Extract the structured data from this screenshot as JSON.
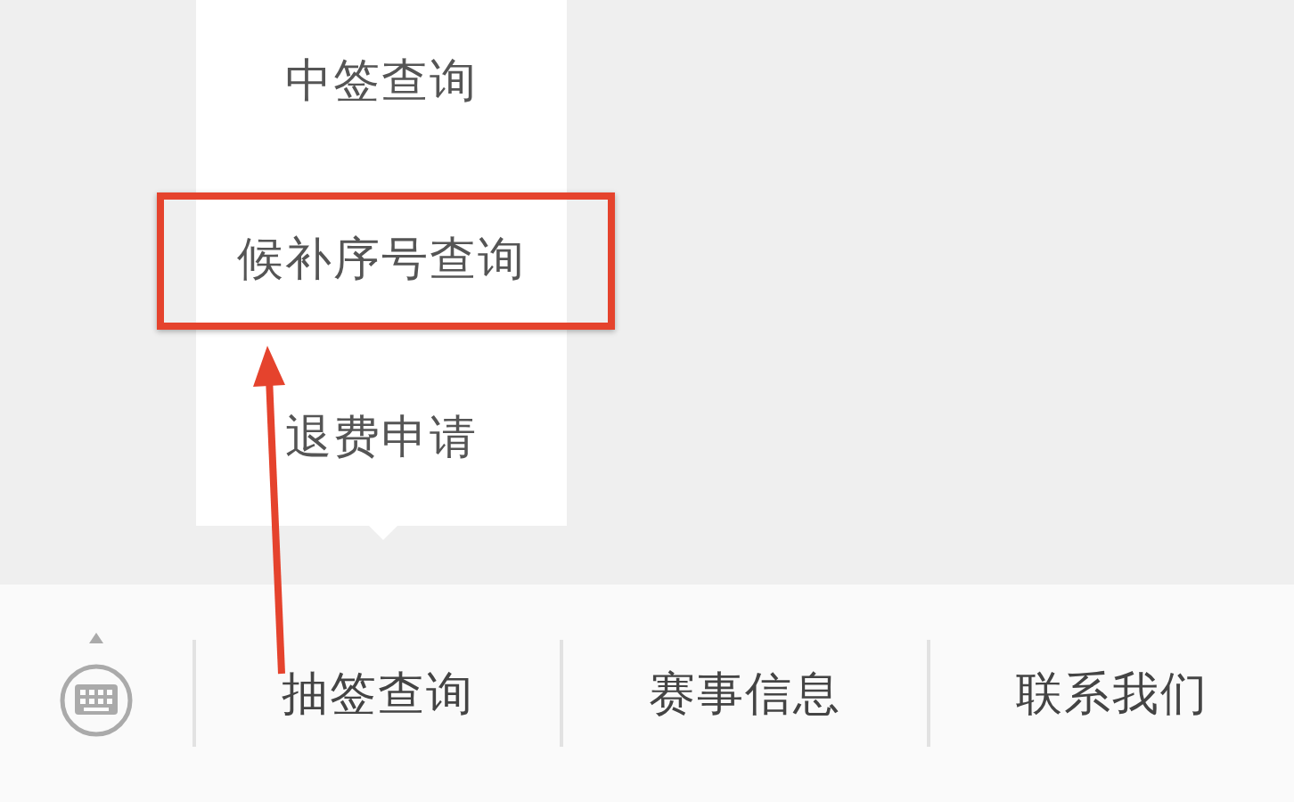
{
  "popup_menu": {
    "items": [
      {
        "label": "中签查询",
        "highlighted": false
      },
      {
        "label": "候补序号查询",
        "highlighted": true
      },
      {
        "label": "退费申请",
        "highlighted": false
      }
    ]
  },
  "bottom_bar": {
    "items": [
      {
        "label": "抽签查询",
        "expanded": true
      },
      {
        "label": "赛事信息",
        "expanded": false
      },
      {
        "label": "联系我们",
        "expanded": false
      }
    ]
  }
}
